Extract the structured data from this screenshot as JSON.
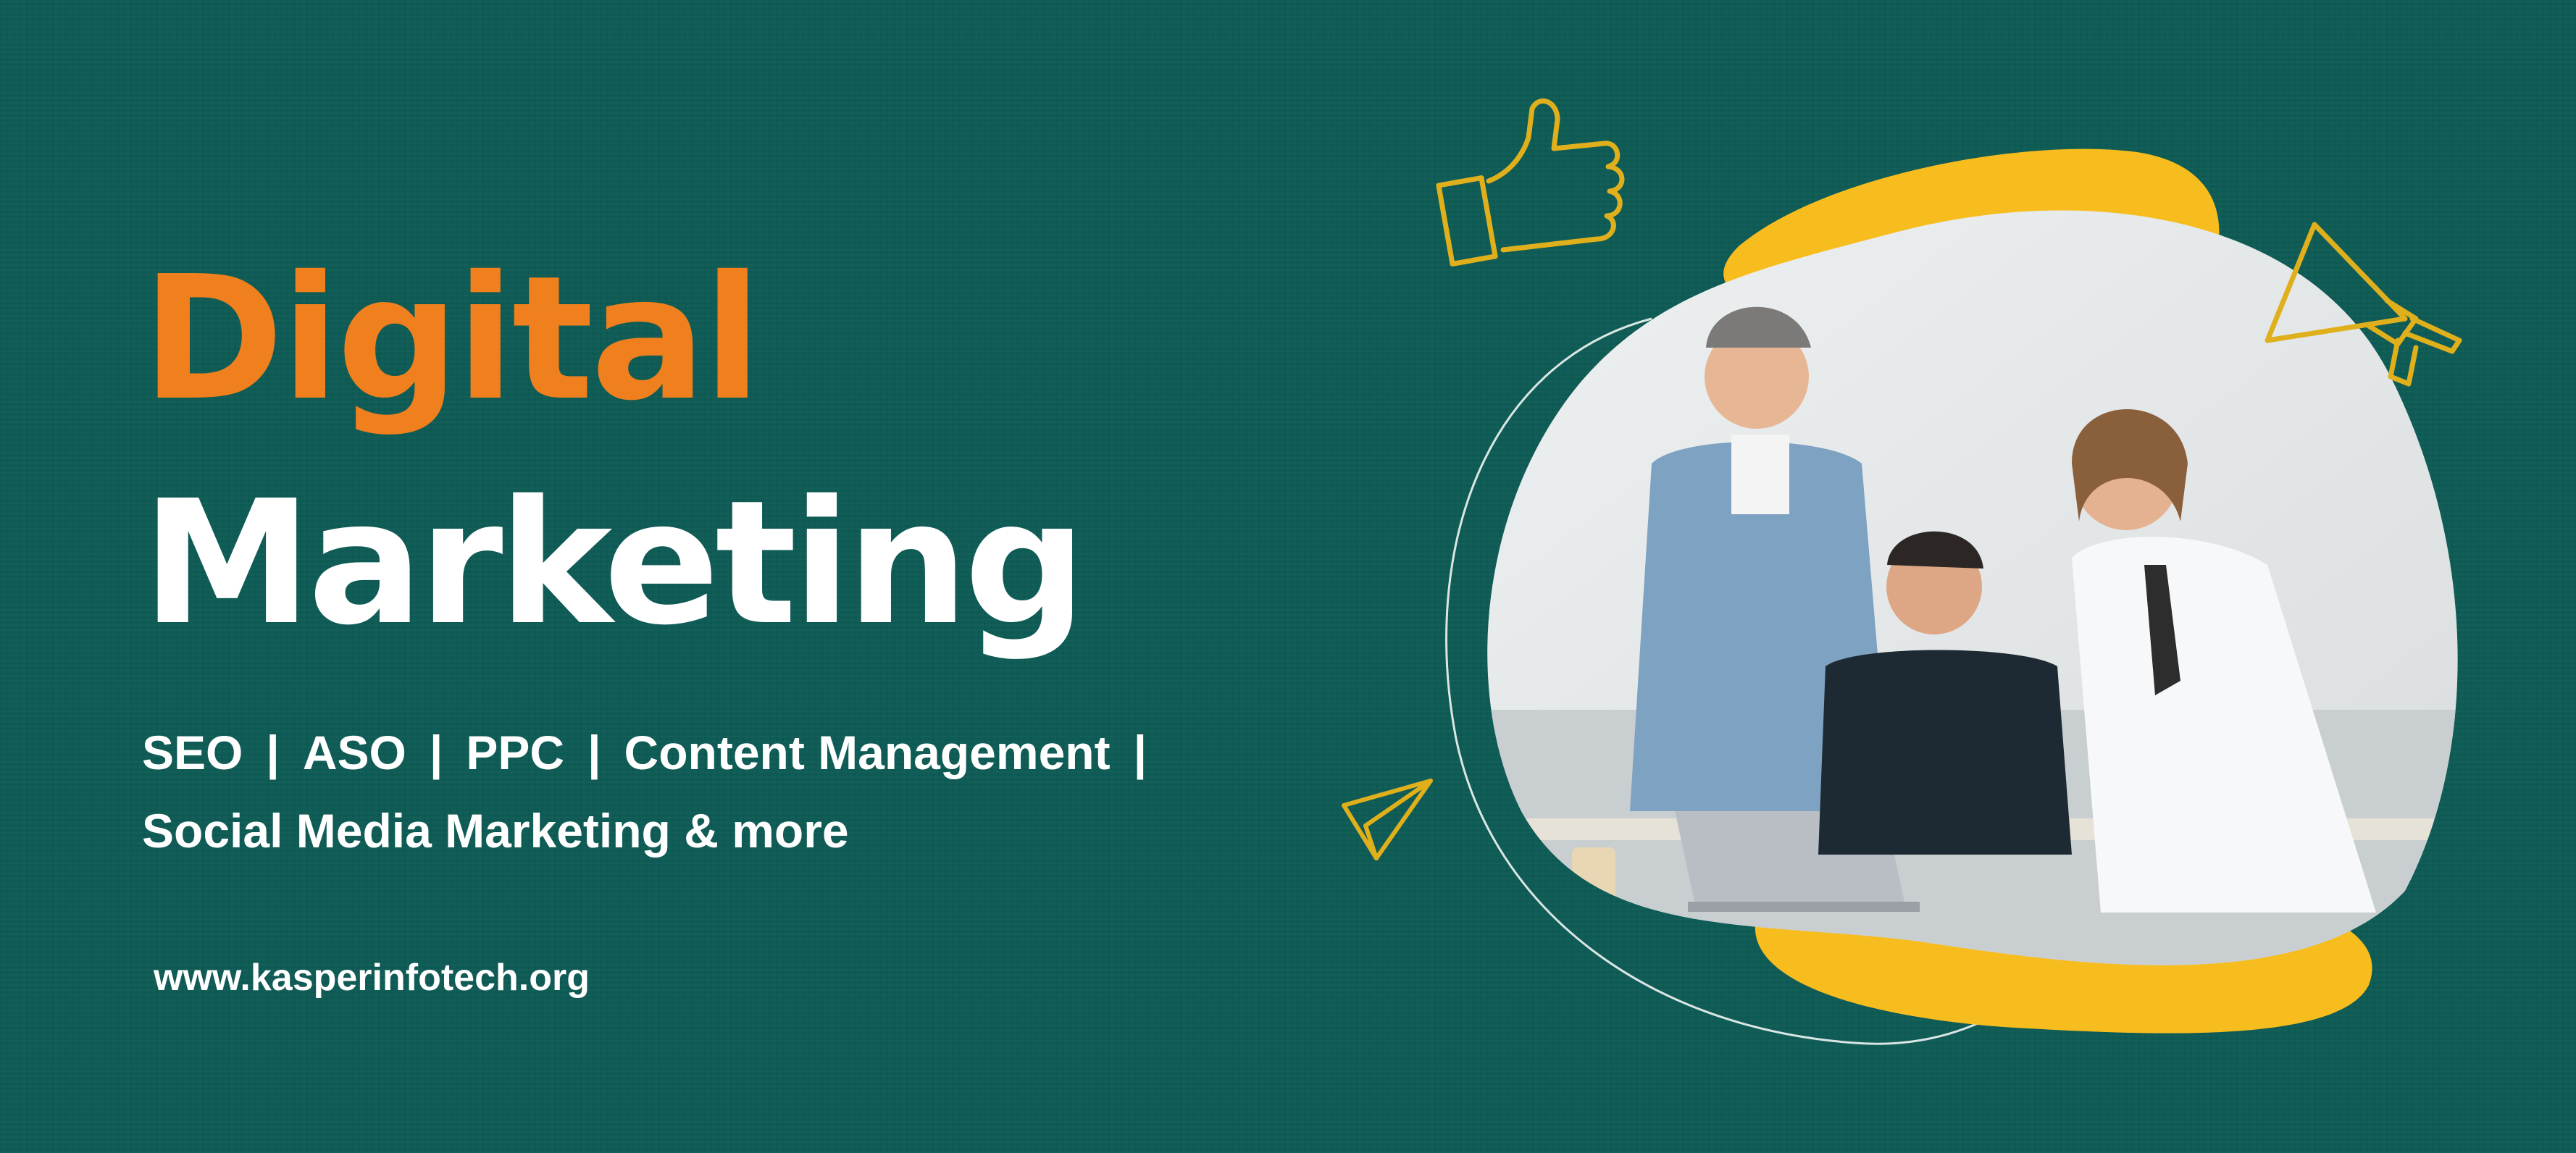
{
  "headline": {
    "line1": "Digital",
    "line2": "Marketing"
  },
  "services": {
    "row1": [
      "SEO",
      "ASO",
      "PPC",
      "Content Management"
    ],
    "separator": "|",
    "row2": "Social Media Marketing  & more"
  },
  "website": "www.kasperinfotech.org",
  "icons": [
    "thumbs-up-icon",
    "megaphone-icon",
    "paper-plane-icon"
  ],
  "photo": {
    "subject": "three smiling men at an office desk with a laptop"
  },
  "colors": {
    "background": "#0f5b55",
    "accent_orange": "#f07f1d",
    "accent_yellow": "#f7bd1f",
    "text_white": "#ffffff",
    "icon_stroke": "#e0b01c"
  }
}
